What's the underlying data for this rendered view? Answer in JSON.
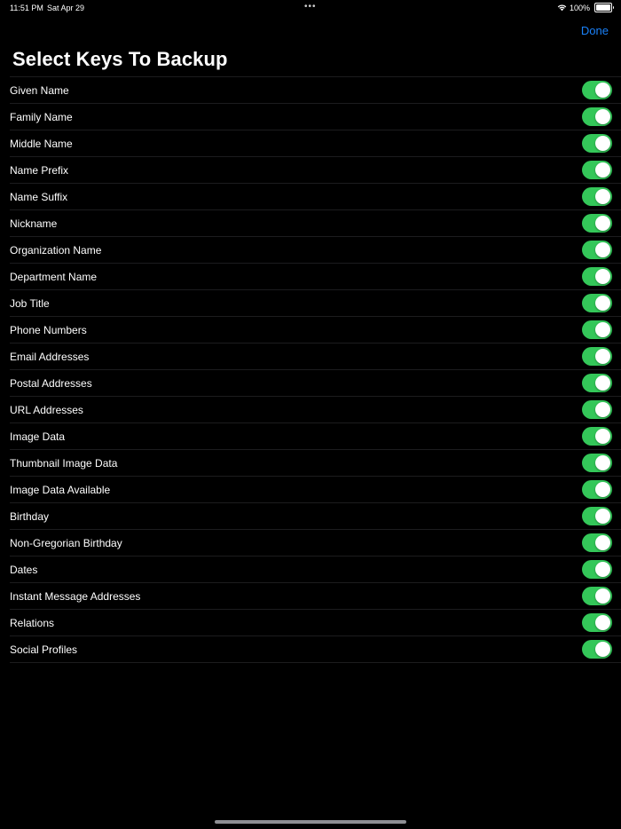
{
  "status_bar": {
    "time": "11:51 PM",
    "date": "Sat Apr 29",
    "multitask_dots": "•••",
    "battery_percent": "100%",
    "battery_level": 1.0
  },
  "nav": {
    "done_label": "Done"
  },
  "title": "Select Keys To Backup",
  "colors": {
    "accent": "#1a82fb",
    "toggle_on": "#34c759",
    "background": "#000000"
  },
  "keys": [
    {
      "label": "Given Name",
      "enabled": true
    },
    {
      "label": "Family Name",
      "enabled": true
    },
    {
      "label": "Middle Name",
      "enabled": true
    },
    {
      "label": "Name Prefix",
      "enabled": true
    },
    {
      "label": "Name Suffix",
      "enabled": true
    },
    {
      "label": "Nickname",
      "enabled": true
    },
    {
      "label": "Organization Name",
      "enabled": true
    },
    {
      "label": "Department Name",
      "enabled": true
    },
    {
      "label": "Job Title",
      "enabled": true
    },
    {
      "label": "Phone Numbers",
      "enabled": true
    },
    {
      "label": "Email Addresses",
      "enabled": true
    },
    {
      "label": "Postal Addresses",
      "enabled": true
    },
    {
      "label": "URL Addresses",
      "enabled": true
    },
    {
      "label": "Image Data",
      "enabled": true
    },
    {
      "label": "Thumbnail Image Data",
      "enabled": true
    },
    {
      "label": "Image Data Available",
      "enabled": true
    },
    {
      "label": "Birthday",
      "enabled": true
    },
    {
      "label": "Non-Gregorian Birthday",
      "enabled": true
    },
    {
      "label": "Dates",
      "enabled": true
    },
    {
      "label": "Instant Message Addresses",
      "enabled": true
    },
    {
      "label": "Relations",
      "enabled": true
    },
    {
      "label": "Social Profiles",
      "enabled": true
    }
  ]
}
